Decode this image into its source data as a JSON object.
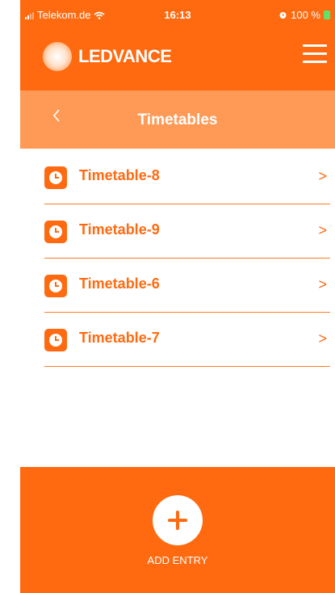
{
  "status_bar": {
    "carrier": "Telekom.de",
    "time": "16:13",
    "battery": "100 %"
  },
  "header": {
    "brand": "LEDVANCE",
    "menu_icon": "hamburger-menu-icon"
  },
  "titlebar": {
    "title": "Timetables",
    "back_glyph": "<"
  },
  "timetables": [
    {
      "label": "Timetable-8"
    },
    {
      "label": "Timetable-9"
    },
    {
      "label": "Timetable-6"
    },
    {
      "label": "Timetable-7"
    }
  ],
  "item_chevron": ">",
  "footer": {
    "add_label": "ADD ENTRY"
  },
  "colors": {
    "accent": "#ff6a11",
    "accent_light": "#ff9a56",
    "battery": "#5ee36a"
  }
}
